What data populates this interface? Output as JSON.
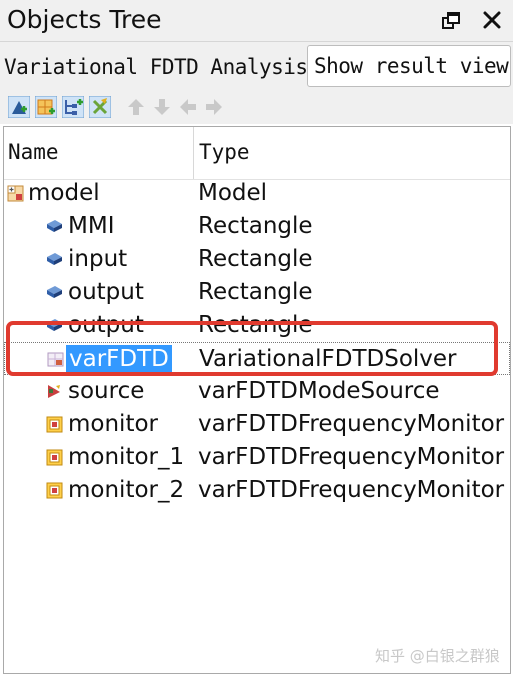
{
  "panel": {
    "title": "Objects Tree"
  },
  "analysis": {
    "label": "Variational FDTD Analysis",
    "show_result_button": "Show result view"
  },
  "toolbar": {
    "buttons": [
      {
        "icon": "add-object-icon",
        "enabled": true
      },
      {
        "icon": "add-grid-icon",
        "enabled": true
      },
      {
        "icon": "add-hierarchy-icon",
        "enabled": true
      },
      {
        "icon": "delete-cross-icon",
        "enabled": true
      },
      {
        "icon": "arrow-up-icon",
        "enabled": false
      },
      {
        "icon": "arrow-down-icon",
        "enabled": false
      },
      {
        "icon": "arrow-left-icon",
        "enabled": false
      },
      {
        "icon": "arrow-right-icon",
        "enabled": false
      }
    ]
  },
  "tree": {
    "columns": [
      "Name",
      "Type"
    ],
    "rows": [
      {
        "name": "model",
        "type": "Model",
        "icon": "model-folder-icon",
        "level": 0
      },
      {
        "name": "MMI",
        "type": "Rectangle",
        "icon": "rectangle-icon",
        "level": 1
      },
      {
        "name": "input",
        "type": "Rectangle",
        "icon": "rectangle-icon",
        "level": 1
      },
      {
        "name": "output",
        "type": "Rectangle",
        "icon": "rectangle-icon",
        "level": 1
      },
      {
        "name": "output",
        "type": "Rectangle",
        "icon": "rectangle-icon",
        "level": 1
      },
      {
        "name": "varFDTD",
        "type": "VariationalFDTDSolver",
        "icon": "solver-icon",
        "level": 1,
        "selected": true
      },
      {
        "name": "source",
        "type": "varFDTDModeSource",
        "icon": "source-icon",
        "level": 1
      },
      {
        "name": "monitor",
        "type": "varFDTDFrequencyMonitor",
        "icon": "monitor-icon",
        "level": 1
      },
      {
        "name": "monitor_1",
        "type": "varFDTDFrequencyMonitor",
        "icon": "monitor-icon",
        "level": 1
      },
      {
        "name": "monitor_2",
        "type": "varFDTDFrequencyMonitor",
        "icon": "monitor-icon",
        "level": 1
      }
    ]
  },
  "watermark": "知乎 @白银之群狼",
  "colors": {
    "selection": "#3399ff",
    "annotation": "#e03a2f"
  }
}
